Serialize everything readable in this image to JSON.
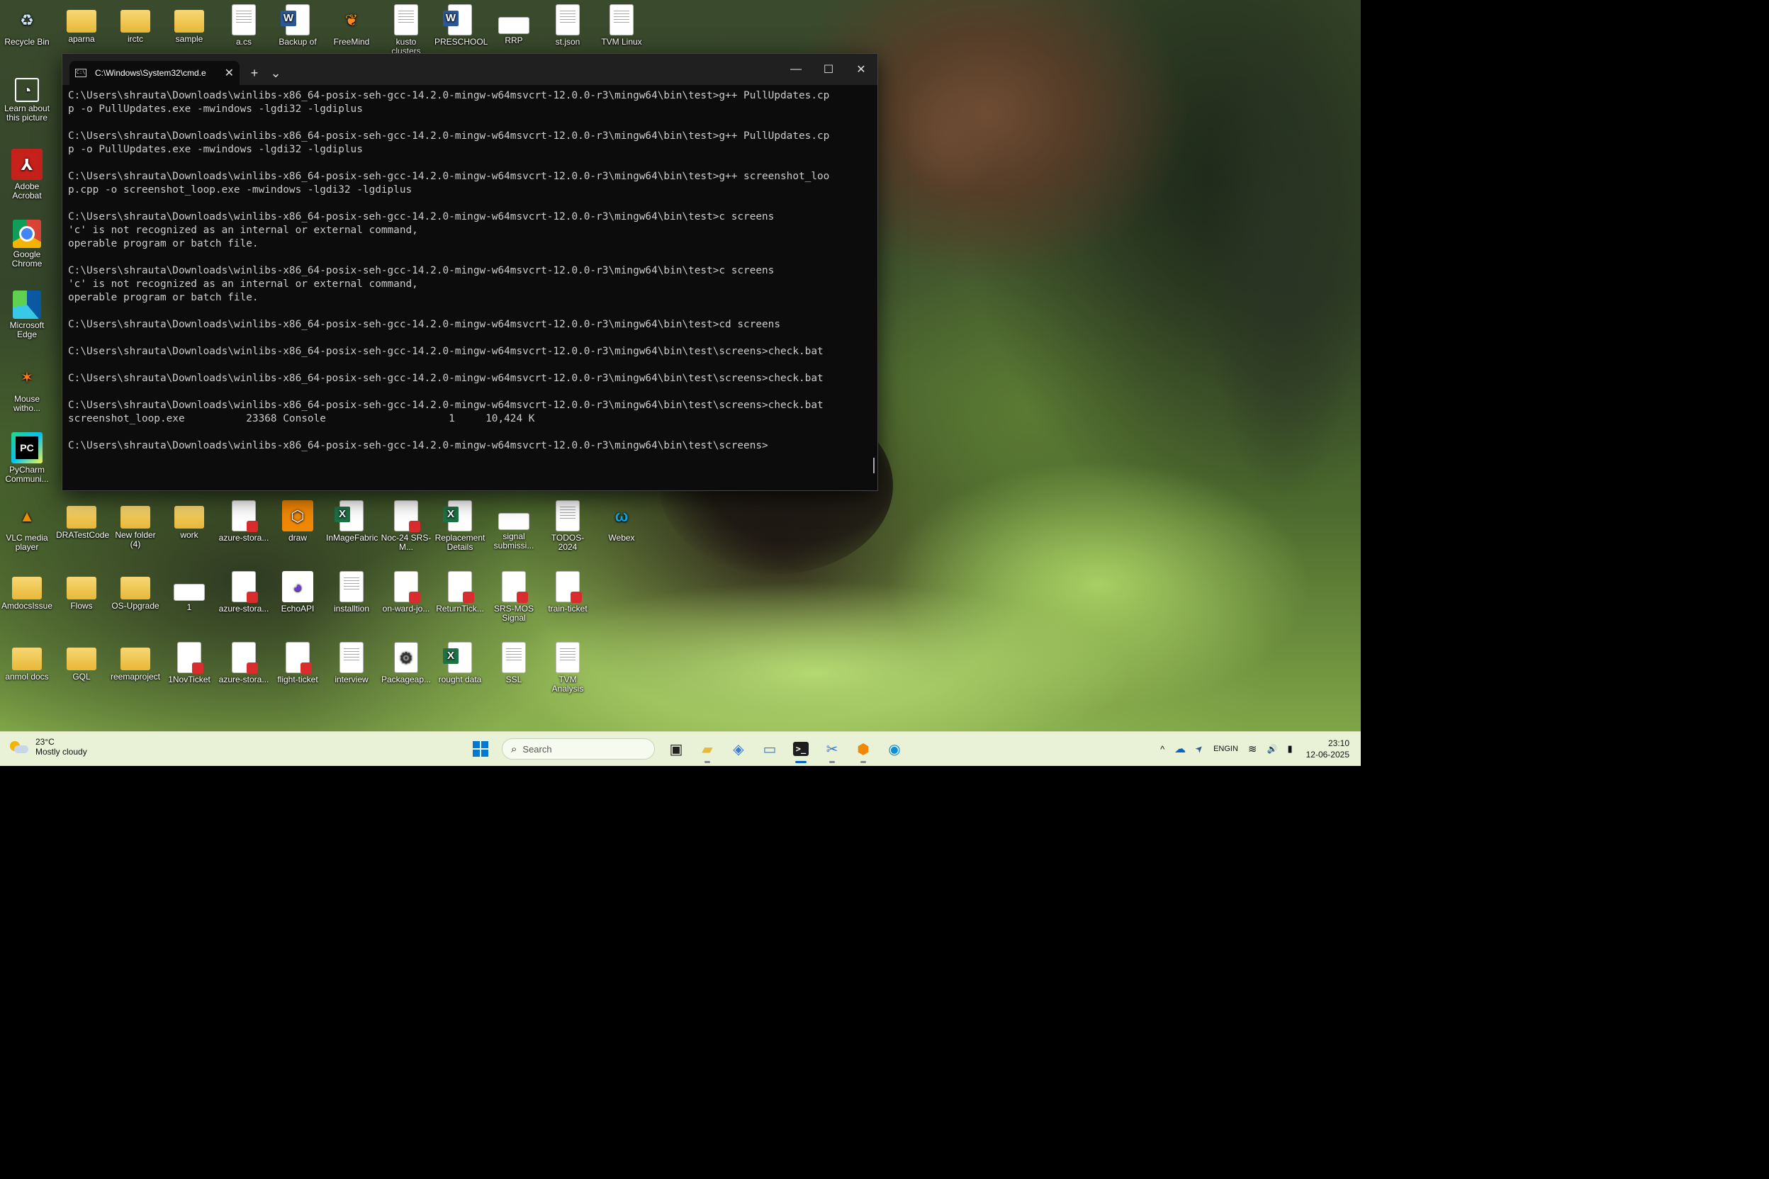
{
  "desktop": {
    "icons_top_row": [
      {
        "label": "Recycle Bin",
        "icon": "recycle-bin-icon"
      },
      {
        "label": "aparna",
        "icon": "folder-icon"
      },
      {
        "label": "irctc",
        "icon": "folder-icon"
      },
      {
        "label": "sample",
        "icon": "folder-icon"
      },
      {
        "label": "a.cs",
        "icon": "document-icon"
      },
      {
        "label": "Backup of",
        "icon": "word-document-icon"
      },
      {
        "label": "FreeMind",
        "icon": "freemind-icon"
      },
      {
        "label": "kusto clusters",
        "icon": "document-icon"
      },
      {
        "label": "PRESCHOOL",
        "icon": "word-document-icon"
      },
      {
        "label": "RRP",
        "icon": "file-icon"
      },
      {
        "label": "st.json",
        "icon": "document-icon"
      },
      {
        "label": "TVM Linux",
        "icon": "document-icon"
      }
    ],
    "icons_left_column": [
      {
        "label": "Learn about this picture",
        "icon": "learn-icon"
      },
      {
        "label": "Adobe Acrobat",
        "icon": "acrobat-icon"
      },
      {
        "label": "Google Chrome",
        "icon": "chrome-icon"
      },
      {
        "label": "Microsoft Edge",
        "icon": "edge-icon"
      },
      {
        "label": "Mouse witho...",
        "icon": "mouse-without-borders-icon"
      },
      {
        "label": "PyCharm Communi...",
        "icon": "pycharm-icon"
      }
    ],
    "icons_row_1": [
      {
        "label": "VLC media player",
        "icon": "vlc-icon"
      },
      {
        "label": "DRATestCode",
        "icon": "folder-icon"
      },
      {
        "label": "New folder (4)",
        "icon": "folder-icon"
      },
      {
        "label": "work",
        "icon": "folder-icon"
      },
      {
        "label": "azure-stora...",
        "icon": "pdf-icon"
      },
      {
        "label": "draw",
        "icon": "drawio-icon"
      },
      {
        "label": "InMageFabric",
        "icon": "excel-icon"
      },
      {
        "label": "Noc-24 SRS-M...",
        "icon": "pdf-icon"
      },
      {
        "label": "Replacement Details",
        "icon": "excel-icon"
      },
      {
        "label": "signal submissi...",
        "icon": "file-icon"
      },
      {
        "label": "TODOS-2024",
        "icon": "document-icon"
      },
      {
        "label": "Webex",
        "icon": "webex-icon"
      }
    ],
    "icons_row_2": [
      {
        "label": "AmdocsIssue",
        "icon": "folder-icon"
      },
      {
        "label": "Flows",
        "icon": "folder-icon"
      },
      {
        "label": "OS-Upgrade",
        "icon": "folder-icon"
      },
      {
        "label": "1",
        "icon": "file-icon"
      },
      {
        "label": "azure-stora...",
        "icon": "pdf-icon"
      },
      {
        "label": "EchoAPI",
        "icon": "echoapi-icon"
      },
      {
        "label": "installtion",
        "icon": "document-icon"
      },
      {
        "label": "on-ward-jo...",
        "icon": "pdf-icon"
      },
      {
        "label": "ReturnTick...",
        "icon": "pdf-icon"
      },
      {
        "label": "SRS-MOS Signal",
        "icon": "pdf-icon"
      },
      {
        "label": "train-ticket",
        "icon": "pdf-icon"
      }
    ],
    "icons_row_3": [
      {
        "label": "anmol docs",
        "icon": "folder-icon"
      },
      {
        "label": "GQL",
        "icon": "folder-icon"
      },
      {
        "label": "reemaproject",
        "icon": "folder-icon"
      },
      {
        "label": "1NovTicket",
        "icon": "pdf-icon"
      },
      {
        "label": "azure-stora...",
        "icon": "pdf-icon"
      },
      {
        "label": "flight-ticket",
        "icon": "pdf-icon"
      },
      {
        "label": "interview",
        "icon": "document-icon"
      },
      {
        "label": "Packageap...",
        "icon": "package-icon"
      },
      {
        "label": "rought data",
        "icon": "excel-icon"
      },
      {
        "label": "SSL",
        "icon": "document-icon"
      },
      {
        "label": "TVM Analysis",
        "icon": "document-icon"
      }
    ]
  },
  "terminal": {
    "tab_title": "C:\\Windows\\System32\\cmd.e",
    "tab_icon_glyph": "C:\\",
    "new_tab_glyph": "+",
    "dropdown_glyph": "⌄",
    "minimize_glyph": "—",
    "maximize_glyph": "☐",
    "close_glyph": "✕",
    "lines": [
      "C:\\Users\\shrauta\\Downloads\\winlibs-x86_64-posix-seh-gcc-14.2.0-mingw-w64msvcrt-12.0.0-r3\\mingw64\\bin\\test>g++ PullUpdates.cp",
      "p -o PullUpdates.exe -mwindows -lgdi32 -lgdiplus",
      "",
      "C:\\Users\\shrauta\\Downloads\\winlibs-x86_64-posix-seh-gcc-14.2.0-mingw-w64msvcrt-12.0.0-r3\\mingw64\\bin\\test>g++ PullUpdates.cp",
      "p -o PullUpdates.exe -mwindows -lgdi32 -lgdiplus",
      "",
      "C:\\Users\\shrauta\\Downloads\\winlibs-x86_64-posix-seh-gcc-14.2.0-mingw-w64msvcrt-12.0.0-r3\\mingw64\\bin\\test>g++ screenshot_loo",
      "p.cpp -o screenshot_loop.exe -mwindows -lgdi32 -lgdiplus",
      "",
      "C:\\Users\\shrauta\\Downloads\\winlibs-x86_64-posix-seh-gcc-14.2.0-mingw-w64msvcrt-12.0.0-r3\\mingw64\\bin\\test>c screens",
      "'c' is not recognized as an internal or external command,",
      "operable program or batch file.",
      "",
      "C:\\Users\\shrauta\\Downloads\\winlibs-x86_64-posix-seh-gcc-14.2.0-mingw-w64msvcrt-12.0.0-r3\\mingw64\\bin\\test>c screens",
      "'c' is not recognized as an internal or external command,",
      "operable program or batch file.",
      "",
      "C:\\Users\\shrauta\\Downloads\\winlibs-x86_64-posix-seh-gcc-14.2.0-mingw-w64msvcrt-12.0.0-r3\\mingw64\\bin\\test>cd screens",
      "",
      "C:\\Users\\shrauta\\Downloads\\winlibs-x86_64-posix-seh-gcc-14.2.0-mingw-w64msvcrt-12.0.0-r3\\mingw64\\bin\\test\\screens>check.bat",
      "",
      "C:\\Users\\shrauta\\Downloads\\winlibs-x86_64-posix-seh-gcc-14.2.0-mingw-w64msvcrt-12.0.0-r3\\mingw64\\bin\\test\\screens>check.bat",
      "",
      "C:\\Users\\shrauta\\Downloads\\winlibs-x86_64-posix-seh-gcc-14.2.0-mingw-w64msvcrt-12.0.0-r3\\mingw64\\bin\\test\\screens>check.bat",
      "screenshot_loop.exe          23368 Console                    1     10,424 K",
      "",
      "C:\\Users\\shrauta\\Downloads\\winlibs-x86_64-posix-seh-gcc-14.2.0-mingw-w64msvcrt-12.0.0-r3\\mingw64\\bin\\test\\screens>"
    ]
  },
  "taskbar": {
    "weather_temp": "23°C",
    "weather_desc": "Mostly cloudy",
    "search_placeholder": "Search",
    "search_glyph": "⌕",
    "apps": [
      {
        "name": "task-view",
        "glyph": "▣",
        "color": "#222222",
        "running": false,
        "active": false
      },
      {
        "name": "file-explorer",
        "glyph": "▰",
        "color": "#e8b838",
        "running": true,
        "active": false
      },
      {
        "name": "microsoft-365",
        "glyph": "◈",
        "color": "#3a7bd5",
        "running": false,
        "active": false
      },
      {
        "name": "window-app",
        "glyph": "▭",
        "color": "#3a7bd5",
        "running": false,
        "active": false
      },
      {
        "name": "terminal",
        "glyph": ">_",
        "color": "#ffffff",
        "running": true,
        "active": true
      },
      {
        "name": "snipping-tool",
        "glyph": "✂",
        "color": "#3a7bd5",
        "running": true,
        "active": false
      },
      {
        "name": "drawio",
        "glyph": "⬢",
        "color": "#f08705",
        "running": true,
        "active": false
      },
      {
        "name": "edge",
        "glyph": "◉",
        "color": "#0c8fd6",
        "running": false,
        "active": false
      }
    ],
    "tray_chevron": "^",
    "onedrive_glyph": "☁",
    "location_glyph": "➤",
    "lang_line1": "ENG",
    "lang_line2": "IN",
    "wifi_glyph": "≋",
    "volume_glyph": "🔊",
    "battery_glyph": "▮",
    "time": "23:10",
    "date": "12-06-2025"
  }
}
